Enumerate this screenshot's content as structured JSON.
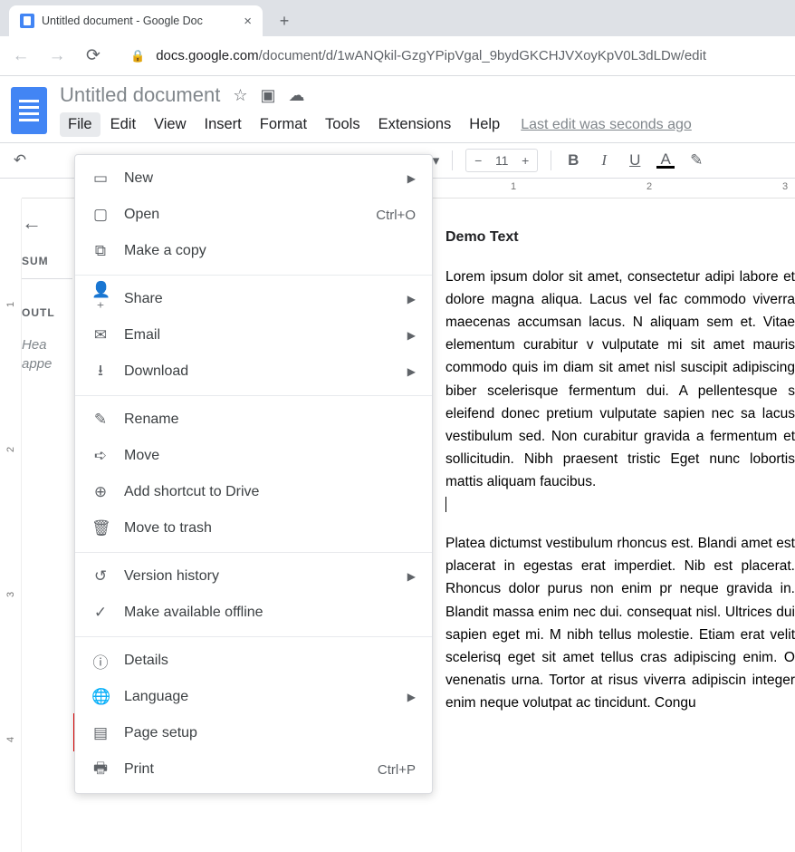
{
  "browser": {
    "tab_title": "Untitled document - Google Doc",
    "url_host": "docs.google.com",
    "url_path": "/document/d/1wANQkil-GzgYPipVgal_9bydGKCHJVXoyKpV0L3dLDw/edit"
  },
  "doc": {
    "title": "Untitled document",
    "last_edit": "Last edit was seconds ago"
  },
  "menubar": [
    "File",
    "Edit",
    "View",
    "Insert",
    "Format",
    "Tools",
    "Extensions",
    "Help"
  ],
  "toolbar": {
    "font_size": "11"
  },
  "ruler": {
    "top": [
      "1",
      "2",
      "3"
    ],
    "left": [
      "1",
      "2",
      "3",
      "4"
    ]
  },
  "outline": {
    "summary_label": "SUM",
    "outline_label": "OUTL",
    "hint_line1": "Hea",
    "hint_line2": "appe"
  },
  "file_menu": {
    "groups": [
      [
        {
          "icon": "file-plus-icon",
          "glyph": "▭",
          "label": "New",
          "arrow": true
        },
        {
          "icon": "folder-open-icon",
          "glyph": "▢",
          "label": "Open",
          "accel": "Ctrl+O"
        },
        {
          "icon": "copy-icon",
          "glyph": "⧉",
          "label": "Make a copy"
        }
      ],
      [
        {
          "icon": "person-plus-icon",
          "glyph": "👤⁺",
          "label": "Share",
          "arrow": true
        },
        {
          "icon": "email-icon",
          "glyph": "✉",
          "label": "Email",
          "arrow": true
        },
        {
          "icon": "download-icon",
          "glyph": "⭳",
          "label": "Download",
          "arrow": true
        }
      ],
      [
        {
          "icon": "rename-icon",
          "glyph": "✎",
          "label": "Rename"
        },
        {
          "icon": "move-icon",
          "glyph": "➪",
          "label": "Move"
        },
        {
          "icon": "drive-shortcut-icon",
          "glyph": "⊕",
          "label": "Add shortcut to Drive"
        },
        {
          "icon": "trash-icon",
          "glyph": "🗑",
          "label": "Move to trash"
        }
      ],
      [
        {
          "icon": "history-icon",
          "glyph": "↺",
          "label": "Version history",
          "arrow": true
        },
        {
          "icon": "offline-icon",
          "glyph": "✓",
          "label": "Make available offline"
        }
      ],
      [
        {
          "icon": "info-icon",
          "glyph": "ⓘ",
          "label": "Details"
        },
        {
          "icon": "globe-icon",
          "glyph": "🌐",
          "label": "Language",
          "arrow": true
        },
        {
          "icon": "page-setup-icon",
          "glyph": "▤",
          "label": "Page setup",
          "highlight": true
        },
        {
          "icon": "print-icon",
          "glyph": "🖶",
          "label": "Print",
          "accel": "Ctrl+P"
        }
      ]
    ]
  },
  "content": {
    "heading": "Demo Text",
    "para1": "Lorem ipsum dolor sit amet, consectetur adipi labore et dolore magna aliqua. Lacus vel fac commodo viverra maecenas accumsan lacus. N aliquam sem et. Vitae elementum curabitur v vulputate mi sit amet mauris commodo quis im diam sit amet nisl suscipit adipiscing biber scelerisque fermentum dui. A pellentesque s eleifend donec pretium vulputate sapien nec sa lacus vestibulum sed. Non curabitur gravida a fermentum et sollicitudin. Nibh praesent tristic Eget nunc lobortis mattis aliquam faucibus.",
    "para2": "Platea dictumst vestibulum rhoncus est. Blandi amet est placerat in egestas erat imperdiet. Nib est placerat. Rhoncus dolor purus non enim pr neque gravida in. Blandit massa enim nec dui. consequat nisl. Ultrices dui sapien eget mi. M nibh tellus molestie. Etiam erat velit scelerisq eget sit amet tellus cras adipiscing enim. O venenatis urna. Tortor at risus viverra adipiscin integer enim neque volutpat ac tincidunt. Congu"
  }
}
